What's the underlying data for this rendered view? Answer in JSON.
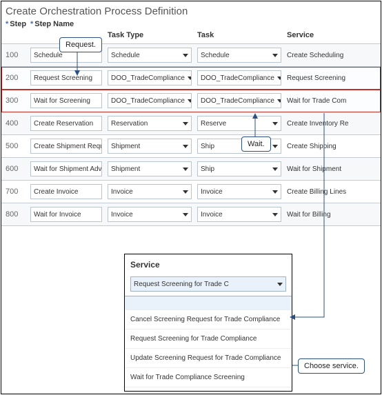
{
  "title": "Create Orchestration Process Definition",
  "columns": {
    "step": "Step",
    "step_name": "Step Name",
    "task_type": "Task Type",
    "task": "Task",
    "service": "Service"
  },
  "callouts": {
    "request": "Request.",
    "wait": "Wait.",
    "choose": "Choose service."
  },
  "rows": [
    {
      "step": "100",
      "name": "Schedule",
      "task_type": "Schedule",
      "task": "Schedule",
      "service": "Create Scheduling"
    },
    {
      "step": "200",
      "name": "Request Screening",
      "task_type": "DOO_TradeCompliance",
      "task": "DOO_TradeCompliance",
      "service": "Request Screening"
    },
    {
      "step": "300",
      "name": "Wait for Screening",
      "task_type": "DOO_TradeCompliance",
      "task": "DOO_TradeCompliance",
      "service": "Wait for Trade Com"
    },
    {
      "step": "400",
      "name": "Create Reservation",
      "task_type": "Reservation",
      "task": "Reserve",
      "service": "Create Inventory Re"
    },
    {
      "step": "500",
      "name": "Create Shipment Request",
      "task_type": "Shipment",
      "task": "Ship",
      "service": "Create Shipping"
    },
    {
      "step": "600",
      "name": "Wait for Shipment Advice",
      "task_type": "Shipment",
      "task": "Ship",
      "service": "Wait for Shipment"
    },
    {
      "step": "700",
      "name": "Create Invoice",
      "task_type": "Invoice",
      "task": "Invoice",
      "service": "Create Billing Lines"
    },
    {
      "step": "800",
      "name": "Wait for Invoice",
      "task_type": "Invoice",
      "task": "Invoice",
      "service": "Wait for Billing"
    }
  ],
  "service_panel": {
    "header": "Service",
    "selected": "Request Screening for Trade C",
    "blank": " ",
    "options": [
      "Cancel Screening Request for Trade Compliance",
      "Request Screening for Trade Compliance",
      "Update Screening Request for Trade Compliance",
      "Wait for Trade Compliance Screening"
    ]
  }
}
